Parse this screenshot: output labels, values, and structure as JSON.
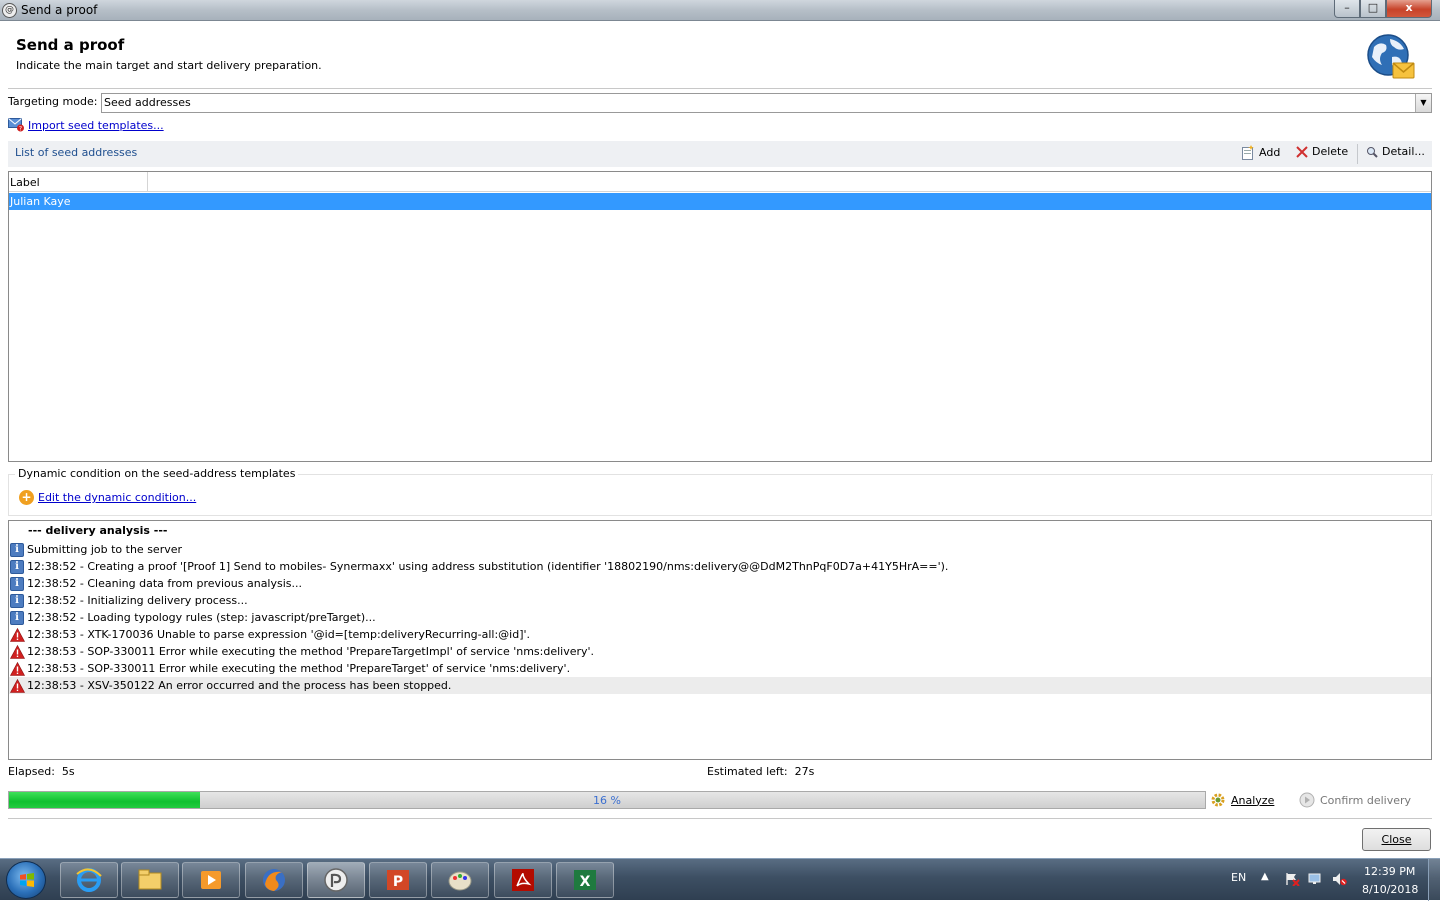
{
  "window": {
    "title": "Send a proof",
    "controls": {
      "minimize": "–",
      "maximize": "□",
      "close": "x"
    }
  },
  "header": {
    "title": "Send a proof",
    "subtitle": "Indicate the main target and start delivery preparation."
  },
  "targeting": {
    "label": "Targeting mode:",
    "value": "Seed addresses",
    "import_link": "Import seed templates..."
  },
  "seed_list": {
    "title": "List of seed addresses",
    "toolbar": {
      "add": "Add",
      "delete": "Delete",
      "detail": "Detail..."
    },
    "columns": [
      "Label"
    ],
    "rows": [
      "Julian Kaye"
    ]
  },
  "dynamic_condition": {
    "title": "Dynamic condition on the seed-address templates",
    "edit_link": "Edit the dynamic condition..."
  },
  "log": {
    "heading": "--- delivery analysis ---",
    "entries": [
      {
        "type": "info",
        "text": "Submitting job to the server"
      },
      {
        "type": "info",
        "text": "12:38:52 - Creating a proof '[Proof 1] Send to mobiles- Synermaxx' using address substitution (identifier '18802190/nms:delivery@@DdM2ThnPqF0D7a+41Y5HrA==')."
      },
      {
        "type": "info",
        "text": "12:38:52 - Cleaning data from previous analysis..."
      },
      {
        "type": "info",
        "text": "12:38:52 - Initializing delivery process..."
      },
      {
        "type": "info",
        "text": "12:38:52 - Loading typology rules (step: javascript/preTarget)..."
      },
      {
        "type": "error",
        "text": "12:38:53 - XTK-170036 Unable to parse expression '@id=[temp:deliveryRecurring-all:@id]'."
      },
      {
        "type": "error",
        "text": "12:38:53 - SOP-330011 Error while executing the method 'PrepareTargetImpl' of service 'nms:delivery'."
      },
      {
        "type": "error",
        "text": "12:38:53 - SOP-330011 Error while executing the method 'PrepareTarget' of service 'nms:delivery'."
      },
      {
        "type": "error",
        "text": "12:38:53 - XSV-350122 An error occurred and the process has been stopped."
      }
    ]
  },
  "status": {
    "elapsed_label": "Elapsed:",
    "elapsed_value": "5s",
    "estimated_label": "Estimated left:",
    "estimated_value": "27s",
    "progress_percent": 16,
    "progress_text": "16 %"
  },
  "actions": {
    "analyze": "Analyze",
    "confirm": "Confirm delivery",
    "close": "Close"
  },
  "taskbar": {
    "apps": [
      "internet-explorer-icon",
      "file-explorer-icon",
      "media-player-icon",
      "firefox-icon",
      "campaign-client-icon",
      "powerpoint-icon",
      "paint-icon",
      "acrobat-icon",
      "excel-icon"
    ],
    "language": "EN",
    "time": "12:39 PM",
    "date": "8/10/2018"
  },
  "colors": {
    "selection": "#3399ff",
    "progress_fill": "#10c030",
    "link": "#0000cc",
    "error_icon": "#d02020",
    "info_icon": "#4d7cc0"
  }
}
